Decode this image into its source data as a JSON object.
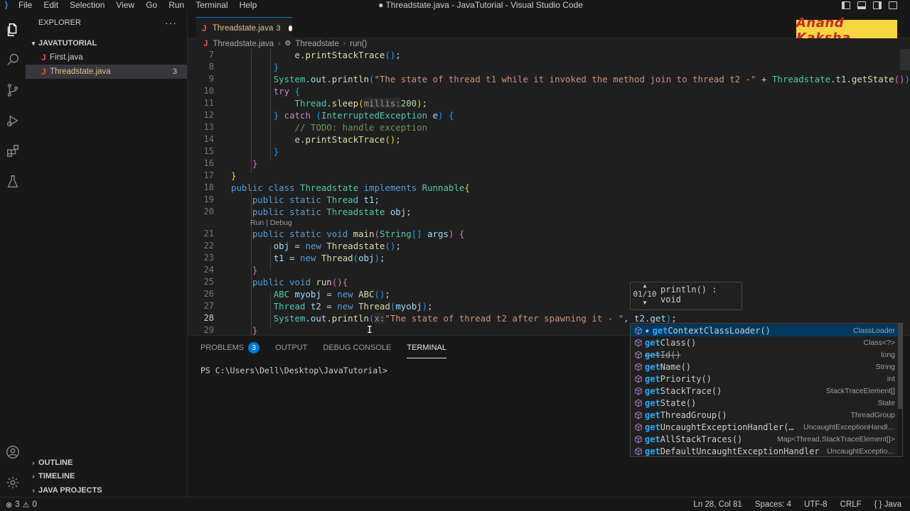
{
  "titlebar": {
    "menu": [
      "File",
      "Edit",
      "Selection",
      "View",
      "Go",
      "Run",
      "Terminal",
      "Help"
    ],
    "title": "● Threadstate.java - JavaTutorial - Visual Studio Code"
  },
  "watermark": "Anand Kaksha",
  "sidebar": {
    "header": "EXPLORER",
    "more": "···",
    "root": "JAVATUTORIAL",
    "files": [
      {
        "name": "First.java",
        "badge": ""
      },
      {
        "name": "Threadstate.java",
        "badge": "3"
      }
    ],
    "sections": [
      "OUTLINE",
      "TIMELINE",
      "JAVA PROJECTS"
    ]
  },
  "tab": {
    "name": "Threadstate.java",
    "badge": "3"
  },
  "breadcrumb": {
    "file": "Threadstate.java",
    "class": "Threadstate",
    "method": "run()"
  },
  "editor": {
    "line_numbers": [
      "7",
      "8",
      "9",
      "10",
      "11",
      "12",
      "13",
      "14",
      "15",
      "16",
      "17",
      "18",
      "19",
      "20",
      "21",
      "22",
      "23",
      "24",
      "25",
      "26",
      "27",
      "28",
      "29"
    ],
    "codelens": "Run | Debug",
    "current_line": "28"
  },
  "param_hint": {
    "count": "01/10",
    "signature": "println() : void"
  },
  "suggestions": [
    {
      "label_hl": "get",
      "label_rest": "ContextClassLoader()",
      "type": "ClassLoader",
      "starred": true,
      "deprecated": false
    },
    {
      "label_hl": "get",
      "label_rest": "Class()",
      "type": "Class<?>",
      "starred": false,
      "deprecated": false
    },
    {
      "label_hl": "get",
      "label_rest": "Id()",
      "type": "long",
      "starred": false,
      "deprecated": true
    },
    {
      "label_hl": "get",
      "label_rest": "Name()",
      "type": "String",
      "starred": false,
      "deprecated": false
    },
    {
      "label_hl": "get",
      "label_rest": "Priority()",
      "type": "int",
      "starred": false,
      "deprecated": false
    },
    {
      "label_hl": "get",
      "label_rest": "StackTrace()",
      "type": "StackTraceElement[]",
      "starred": false,
      "deprecated": false
    },
    {
      "label_hl": "get",
      "label_rest": "State()",
      "type": "State",
      "starred": false,
      "deprecated": false
    },
    {
      "label_hl": "get",
      "label_rest": "ThreadGroup()",
      "type": "ThreadGroup",
      "starred": false,
      "deprecated": false
    },
    {
      "label_hl": "get",
      "label_rest": "UncaughtExceptionHandler(…",
      "type": "UncaughtExceptionHandl…",
      "starred": false,
      "deprecated": false
    },
    {
      "label_hl": "get",
      "label_rest": "AllStackTraces()",
      "type": "Map<Thread,StackTraceElement[]>",
      "starred": false,
      "deprecated": false
    },
    {
      "label_hl": "get",
      "label_rest": "DefaultUncaughtExceptionHandler",
      "type": "UncaughtExceptio…",
      "starred": false,
      "deprecated": false
    }
  ],
  "panel": {
    "tabs": [
      "PROBLEMS",
      "OUTPUT",
      "DEBUG CONSOLE",
      "TERMINAL"
    ],
    "problems_count": "3",
    "terminal_prompt": "PS C:\\Users\\Dell\\Desktop\\JavaTutorial>"
  },
  "statusbar": {
    "errors": "3",
    "warnings": "0",
    "position": "Ln 28, Col 81",
    "spaces": "Spaces: 4",
    "encoding": "UTF-8",
    "eol": "CRLF",
    "language": "{ } Java"
  },
  "colors": {
    "accent": "#0078d4",
    "warning": "#e2c08d",
    "error": "#f14c4c"
  }
}
